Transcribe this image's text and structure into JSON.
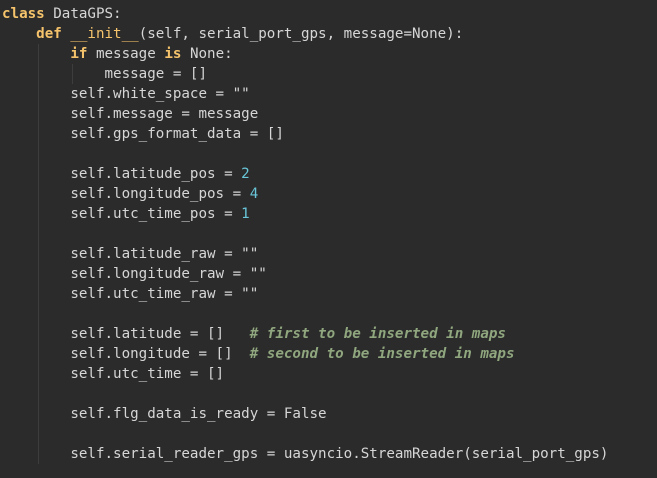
{
  "editor": {
    "language": "python",
    "colors": {
      "background": "#2b2b2b",
      "keyword": "#f5c36b",
      "function_name": "#f5c36b",
      "plain": "#d6d6d6",
      "number": "#69c7d9",
      "comment": "#8fa67e"
    },
    "lines": [
      [
        {
          "t": "kw",
          "v": "class"
        },
        {
          "t": "pl",
          "v": " DataGPS:"
        }
      ],
      [
        {
          "t": "pl",
          "v": "    "
        },
        {
          "t": "kw",
          "v": "def"
        },
        {
          "t": "pl",
          "v": " "
        },
        {
          "t": "fn",
          "v": "__init__"
        },
        {
          "t": "pl",
          "v": "(self, serial_port_gps, message=None):"
        }
      ],
      [
        {
          "t": "pl",
          "v": "        "
        },
        {
          "t": "kw",
          "v": "if"
        },
        {
          "t": "pl",
          "v": " message "
        },
        {
          "t": "kw",
          "v": "is"
        },
        {
          "t": "pl",
          "v": " None:"
        }
      ],
      [
        {
          "t": "pl",
          "v": "            message = []"
        }
      ],
      [
        {
          "t": "pl",
          "v": "        self.white_space = \"\""
        }
      ],
      [
        {
          "t": "pl",
          "v": "        self.message = message"
        }
      ],
      [
        {
          "t": "pl",
          "v": "        self.gps_format_data = []"
        }
      ],
      [],
      [
        {
          "t": "pl",
          "v": "        self.latitude_pos = "
        },
        {
          "t": "num",
          "v": "2"
        }
      ],
      [
        {
          "t": "pl",
          "v": "        self.longitude_pos = "
        },
        {
          "t": "num",
          "v": "4"
        }
      ],
      [
        {
          "t": "pl",
          "v": "        self.utc_time_pos = "
        },
        {
          "t": "num",
          "v": "1"
        }
      ],
      [],
      [
        {
          "t": "pl",
          "v": "        self.latitude_raw = \"\""
        }
      ],
      [
        {
          "t": "pl",
          "v": "        self.longitude_raw = \"\""
        }
      ],
      [
        {
          "t": "pl",
          "v": "        self.utc_time_raw = \"\""
        }
      ],
      [],
      [
        {
          "t": "pl",
          "v": "        self.latitude = []   "
        },
        {
          "t": "cm",
          "v": "# first to be inserted in maps"
        }
      ],
      [
        {
          "t": "pl",
          "v": "        self.longitude = []  "
        },
        {
          "t": "cm",
          "v": "# second to be inserted in maps"
        }
      ],
      [
        {
          "t": "pl",
          "v": "        self.utc_time = []"
        }
      ],
      [],
      [
        {
          "t": "pl",
          "v": "        self.flg_data_is_ready = False"
        }
      ],
      [],
      [
        {
          "t": "pl",
          "v": "        self.serial_reader_gps = uasyncio.StreamReader(serial_port_gps)"
        }
      ]
    ]
  }
}
